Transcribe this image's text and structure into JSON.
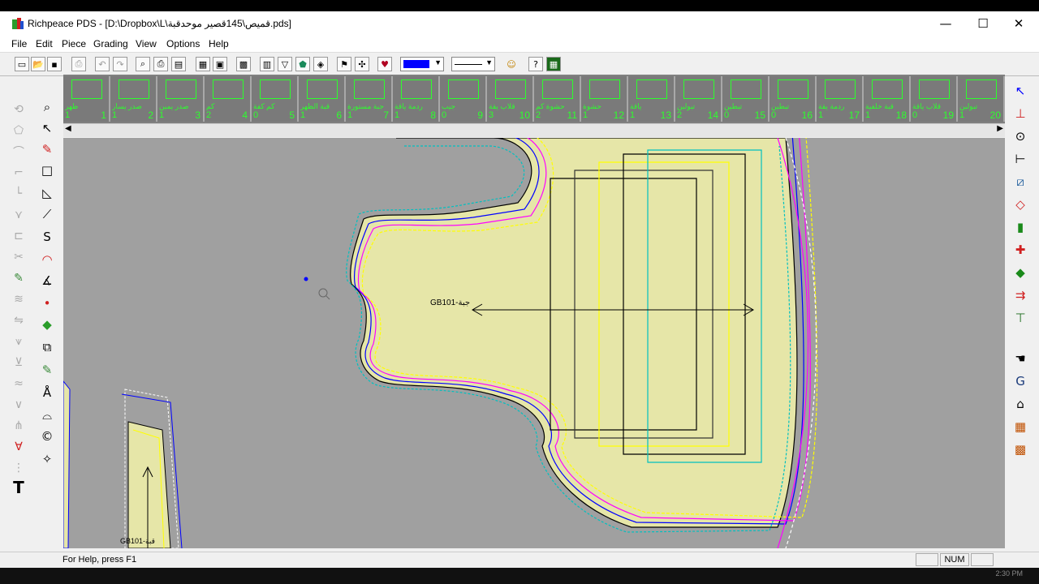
{
  "window": {
    "app_name": "Richpeace PDS",
    "title": "Richpeace PDS - [D:\\Dropbox\\L\\قميص\\145قصير موحدقبة.pds]",
    "minimize_glyph": "—",
    "maximize_glyph": "☐",
    "close_glyph": "✕"
  },
  "menu": [
    "File",
    "Edit",
    "Piece",
    "Grading",
    "View",
    "Options",
    "Help"
  ],
  "toolbar": {
    "icons": [
      "new-icon",
      "open-icon",
      "save-icon",
      "import-icon",
      "undo-icon",
      "redo-icon",
      "print-preview-icon",
      "print-icon",
      "plot-icon",
      "grid-view-icon",
      "piece-list-icon",
      "measure-table-icon",
      "grade-rules-icon",
      "notch-icon",
      "stitch-icon",
      "symmetry-icon",
      "flag-icon",
      "point-icon",
      "heart-icon"
    ],
    "line_color": "#0000ff",
    "line_style": "solid"
  },
  "pieces": [
    {
      "num": "1",
      "name": "ظهر",
      "qty": "1"
    },
    {
      "num": "2",
      "name": "صدر يسار",
      "qty": "1"
    },
    {
      "num": "3",
      "name": "صدر يمين",
      "qty": "1"
    },
    {
      "num": "4",
      "name": "كم",
      "qty": "2"
    },
    {
      "num": "5",
      "name": "كم كفة",
      "qty": "0"
    },
    {
      "num": "6",
      "name": "قبة الظهر",
      "qty": "1"
    },
    {
      "num": "7",
      "name": "جبة مستورة",
      "qty": "1"
    },
    {
      "num": "8",
      "name": "ردمة ياقة",
      "qty": "1"
    },
    {
      "num": "9",
      "name": "جيب",
      "qty": "0"
    },
    {
      "num": "10",
      "name": "قلاب يقة",
      "qty": "3"
    },
    {
      "num": "11",
      "name": "حشوة كم",
      "qty": "2"
    },
    {
      "num": "12",
      "name": "حشوة",
      "qty": "1"
    },
    {
      "num": "13",
      "name": "ياقة",
      "qty": "1"
    },
    {
      "num": "14",
      "name": "تبولين",
      "qty": "2"
    },
    {
      "num": "15",
      "name": "تبطين",
      "qty": "0"
    },
    {
      "num": "16",
      "name": "تبطين",
      "qty": "0"
    },
    {
      "num": "17",
      "name": "ردمة يقة",
      "qty": "1"
    },
    {
      "num": "18",
      "name": "قبة خلفية",
      "qty": "1"
    },
    {
      "num": "19",
      "name": "قلاب ياقة",
      "qty": "0"
    },
    {
      "num": "20",
      "name": "تبولين",
      "qty": "1"
    }
  ],
  "canvas": {
    "main_piece_label": "GB101-جبة",
    "side_piece_label": "GB101-قبة",
    "background": "#a0a0a0",
    "piece_fill": "#e6e6a8",
    "outline_colors": [
      "#000000",
      "#0000ff",
      "#ff00ff",
      "#ffff00",
      "#00c0c0",
      "#ffffff",
      "#ff0000"
    ]
  },
  "status": {
    "help_text": "For Help, press F1",
    "num_indicator": "NUM"
  },
  "taskbar": {
    "clock": "2:30 PM"
  }
}
